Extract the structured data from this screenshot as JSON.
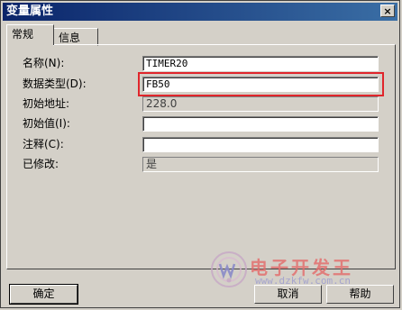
{
  "window": {
    "title": "变量属性",
    "close_glyph": "×"
  },
  "tabs": [
    {
      "label": "常规",
      "active": true
    },
    {
      "label": "信息",
      "active": false
    }
  ],
  "fields": [
    {
      "label": "名称(N):",
      "value": "TIMER20",
      "editable": true
    },
    {
      "label": "数据类型(D):",
      "value": "FB50",
      "editable": true,
      "highlighted": true
    },
    {
      "label": "初始地址:",
      "value": "228.0",
      "editable": false
    },
    {
      "label": "初始值(I):",
      "value": "",
      "editable": true
    },
    {
      "label": "注释(C):",
      "value": "",
      "editable": true
    },
    {
      "label": "已修改:",
      "value": "是",
      "editable": false
    }
  ],
  "buttons": {
    "ok": "确定",
    "cancel": "取消",
    "help": "帮助"
  },
  "watermark": {
    "text": "电子开发王",
    "url": "www.dzkfw.com.cn"
  },
  "colors": {
    "titlebar_start": "#0a246a",
    "titlebar_end": "#3a6ea5",
    "highlight_border": "#e0252b",
    "dialog_bg": "#d4d0c8"
  }
}
